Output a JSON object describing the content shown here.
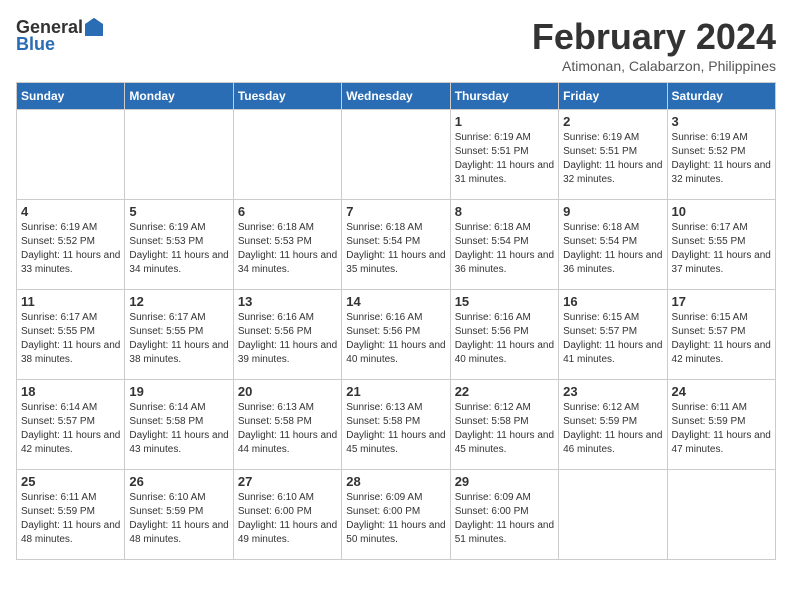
{
  "header": {
    "logo_general": "General",
    "logo_blue": "Blue",
    "title": "February 2024",
    "location": "Atimonan, Calabarzon, Philippines"
  },
  "weekdays": [
    "Sunday",
    "Monday",
    "Tuesday",
    "Wednesday",
    "Thursday",
    "Friday",
    "Saturday"
  ],
  "weeks": [
    [
      {
        "day": "",
        "info": ""
      },
      {
        "day": "",
        "info": ""
      },
      {
        "day": "",
        "info": ""
      },
      {
        "day": "",
        "info": ""
      },
      {
        "day": "1",
        "info": "Sunrise: 6:19 AM\nSunset: 5:51 PM\nDaylight: 11 hours and 31 minutes."
      },
      {
        "day": "2",
        "info": "Sunrise: 6:19 AM\nSunset: 5:51 PM\nDaylight: 11 hours and 32 minutes."
      },
      {
        "day": "3",
        "info": "Sunrise: 6:19 AM\nSunset: 5:52 PM\nDaylight: 11 hours and 32 minutes."
      }
    ],
    [
      {
        "day": "4",
        "info": "Sunrise: 6:19 AM\nSunset: 5:52 PM\nDaylight: 11 hours and 33 minutes."
      },
      {
        "day": "5",
        "info": "Sunrise: 6:19 AM\nSunset: 5:53 PM\nDaylight: 11 hours and 34 minutes."
      },
      {
        "day": "6",
        "info": "Sunrise: 6:18 AM\nSunset: 5:53 PM\nDaylight: 11 hours and 34 minutes."
      },
      {
        "day": "7",
        "info": "Sunrise: 6:18 AM\nSunset: 5:54 PM\nDaylight: 11 hours and 35 minutes."
      },
      {
        "day": "8",
        "info": "Sunrise: 6:18 AM\nSunset: 5:54 PM\nDaylight: 11 hours and 36 minutes."
      },
      {
        "day": "9",
        "info": "Sunrise: 6:18 AM\nSunset: 5:54 PM\nDaylight: 11 hours and 36 minutes."
      },
      {
        "day": "10",
        "info": "Sunrise: 6:17 AM\nSunset: 5:55 PM\nDaylight: 11 hours and 37 minutes."
      }
    ],
    [
      {
        "day": "11",
        "info": "Sunrise: 6:17 AM\nSunset: 5:55 PM\nDaylight: 11 hours and 38 minutes."
      },
      {
        "day": "12",
        "info": "Sunrise: 6:17 AM\nSunset: 5:55 PM\nDaylight: 11 hours and 38 minutes."
      },
      {
        "day": "13",
        "info": "Sunrise: 6:16 AM\nSunset: 5:56 PM\nDaylight: 11 hours and 39 minutes."
      },
      {
        "day": "14",
        "info": "Sunrise: 6:16 AM\nSunset: 5:56 PM\nDaylight: 11 hours and 40 minutes."
      },
      {
        "day": "15",
        "info": "Sunrise: 6:16 AM\nSunset: 5:56 PM\nDaylight: 11 hours and 40 minutes."
      },
      {
        "day": "16",
        "info": "Sunrise: 6:15 AM\nSunset: 5:57 PM\nDaylight: 11 hours and 41 minutes."
      },
      {
        "day": "17",
        "info": "Sunrise: 6:15 AM\nSunset: 5:57 PM\nDaylight: 11 hours and 42 minutes."
      }
    ],
    [
      {
        "day": "18",
        "info": "Sunrise: 6:14 AM\nSunset: 5:57 PM\nDaylight: 11 hours and 42 minutes."
      },
      {
        "day": "19",
        "info": "Sunrise: 6:14 AM\nSunset: 5:58 PM\nDaylight: 11 hours and 43 minutes."
      },
      {
        "day": "20",
        "info": "Sunrise: 6:13 AM\nSunset: 5:58 PM\nDaylight: 11 hours and 44 minutes."
      },
      {
        "day": "21",
        "info": "Sunrise: 6:13 AM\nSunset: 5:58 PM\nDaylight: 11 hours and 45 minutes."
      },
      {
        "day": "22",
        "info": "Sunrise: 6:12 AM\nSunset: 5:58 PM\nDaylight: 11 hours and 45 minutes."
      },
      {
        "day": "23",
        "info": "Sunrise: 6:12 AM\nSunset: 5:59 PM\nDaylight: 11 hours and 46 minutes."
      },
      {
        "day": "24",
        "info": "Sunrise: 6:11 AM\nSunset: 5:59 PM\nDaylight: 11 hours and 47 minutes."
      }
    ],
    [
      {
        "day": "25",
        "info": "Sunrise: 6:11 AM\nSunset: 5:59 PM\nDaylight: 11 hours and 48 minutes."
      },
      {
        "day": "26",
        "info": "Sunrise: 6:10 AM\nSunset: 5:59 PM\nDaylight: 11 hours and 48 minutes."
      },
      {
        "day": "27",
        "info": "Sunrise: 6:10 AM\nSunset: 6:00 PM\nDaylight: 11 hours and 49 minutes."
      },
      {
        "day": "28",
        "info": "Sunrise: 6:09 AM\nSunset: 6:00 PM\nDaylight: 11 hours and 50 minutes."
      },
      {
        "day": "29",
        "info": "Sunrise: 6:09 AM\nSunset: 6:00 PM\nDaylight: 11 hours and 51 minutes."
      },
      {
        "day": "",
        "info": ""
      },
      {
        "day": "",
        "info": ""
      }
    ]
  ]
}
